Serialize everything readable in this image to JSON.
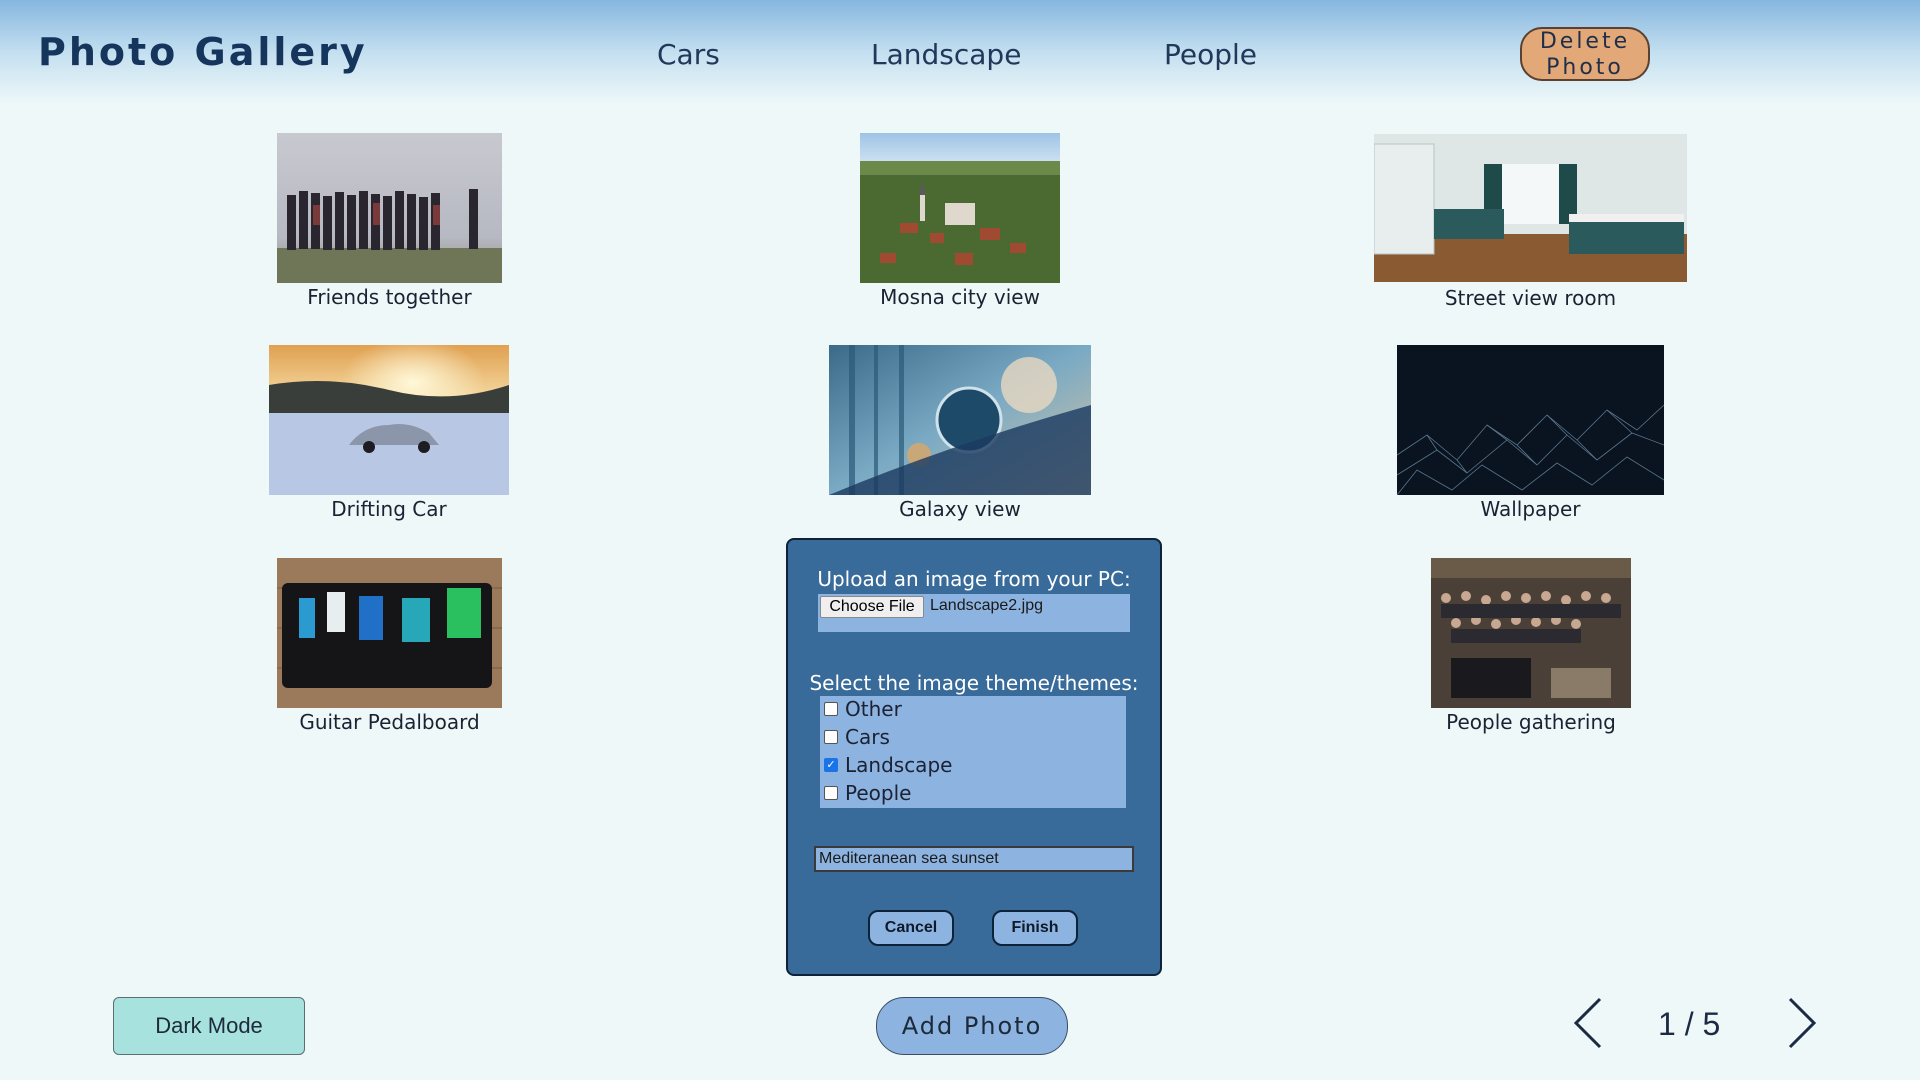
{
  "header": {
    "title": "Photo Gallery",
    "nav": [
      "Cars",
      "Landscape",
      "People"
    ],
    "delete_label_line1": "Delete",
    "delete_label_line2": "Photo"
  },
  "photos": [
    {
      "caption": "Friends together",
      "icon": "group-of-friends-photo"
    },
    {
      "caption": "Mosna city view",
      "icon": "aerial-town-photo"
    },
    {
      "caption": "Street view room",
      "icon": "bedroom-photo"
    },
    {
      "caption": "Drifting Car",
      "icon": "car-on-snow-photo"
    },
    {
      "caption": "Galaxy view",
      "icon": "abstract-galaxy-photo"
    },
    {
      "caption": "Wallpaper",
      "icon": "network-wallpaper-photo"
    },
    {
      "caption": "Guitar Pedalboard",
      "icon": "pedalboard-photo"
    },
    {
      "caption": "People gathering",
      "icon": "crowd-photo"
    }
  ],
  "upload_modal": {
    "upload_label": "Upload an image from your PC:",
    "choose_file_label": "Choose File",
    "file_name": "Landscape2.jpg",
    "theme_label": "Select the image theme/themes:",
    "themes": [
      {
        "label": "Other",
        "checked": false
      },
      {
        "label": "Cars",
        "checked": false
      },
      {
        "label": "Landscape",
        "checked": true
      },
      {
        "label": "People",
        "checked": false
      }
    ],
    "description_value": "Mediteranean sea sunset",
    "cancel_label": "Cancel",
    "finish_label": "Finish"
  },
  "footer": {
    "dark_mode_label": "Dark Mode",
    "add_photo_label": "Add Photo",
    "page_indicator": "1 / 5",
    "prev_icon": "chevron-left-icon",
    "next_icon": "chevron-right-icon"
  },
  "colors": {
    "accent": "#386a9a",
    "panel": "#8db3e0",
    "delete": "#e2a878",
    "dark_mode": "#a8e2df"
  }
}
